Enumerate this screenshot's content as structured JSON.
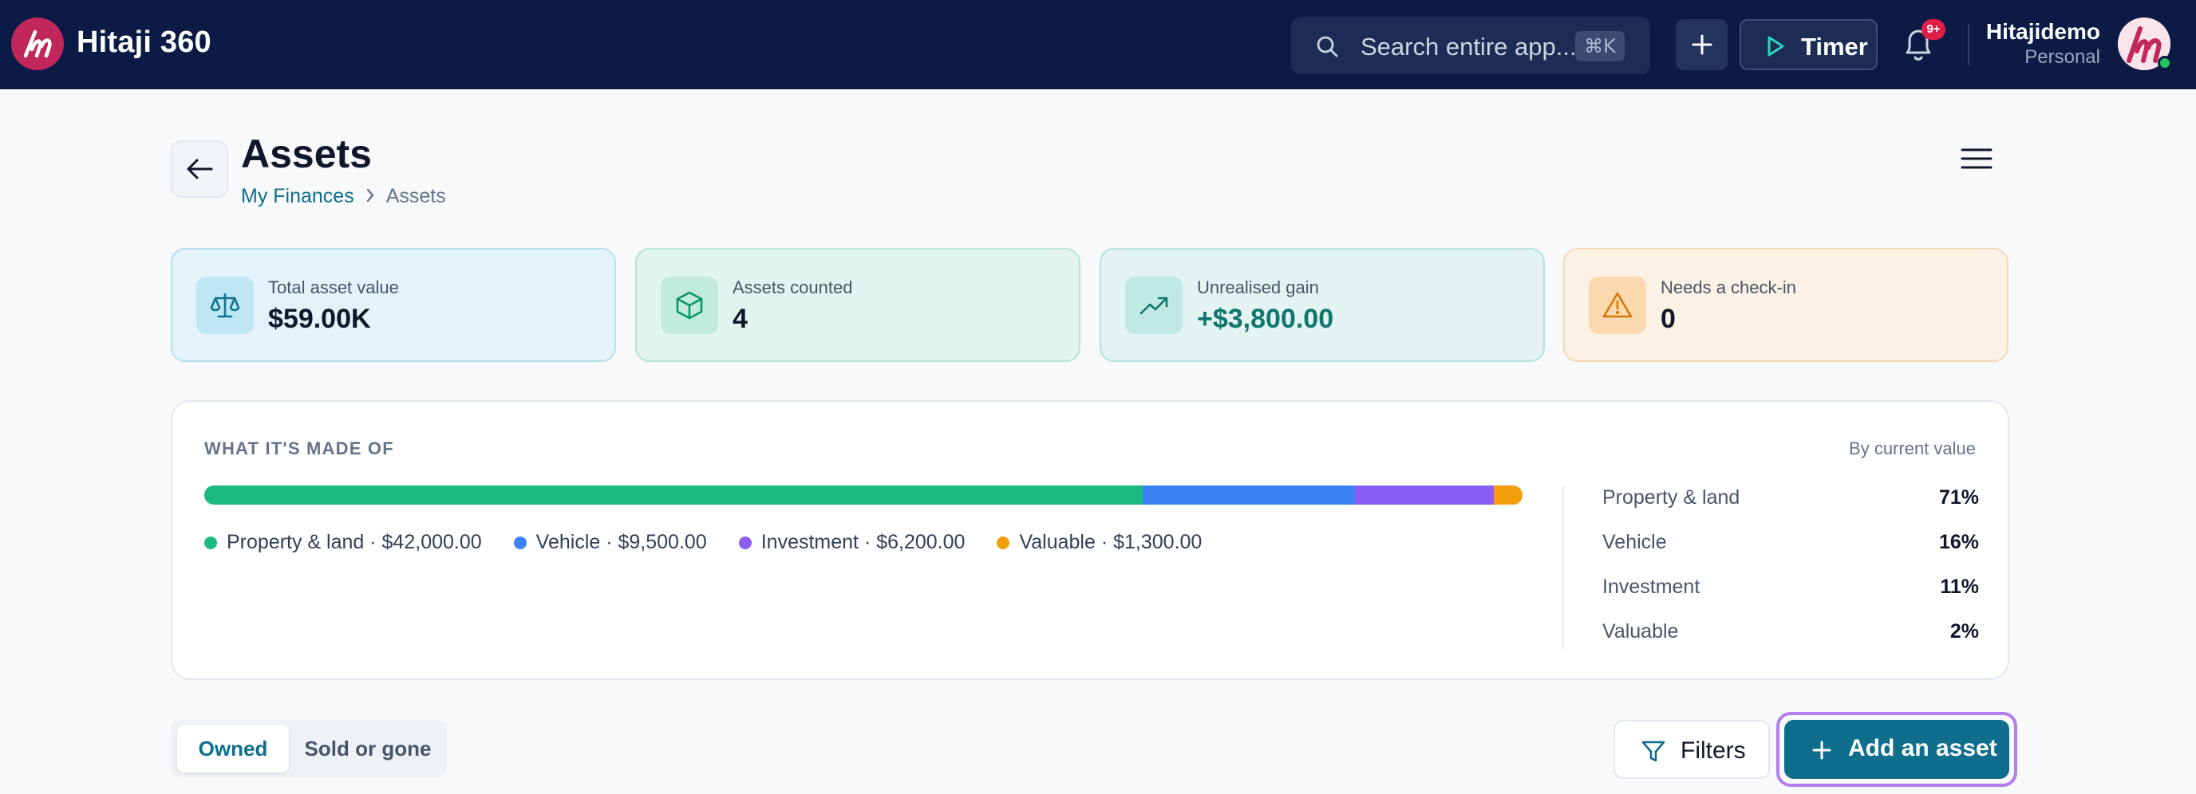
{
  "app": {
    "title": "Hitaji 360",
    "logo_icon": "hitaji-logo-icon"
  },
  "topbar": {
    "search_placeholder": "Search entire app...",
    "search_shortcut": "⌘K",
    "timer_label": "Timer",
    "notifications_badge": "9+",
    "user_name": "Hitajidemo",
    "user_plan": "Personal"
  },
  "page": {
    "title": "Assets",
    "breadcrumb": {
      "parent": "My Finances",
      "current": "Assets"
    }
  },
  "stats": [
    {
      "label": "Total asset value",
      "value": "$59.00K",
      "icon": "scale-icon",
      "accent": "#0e7490"
    },
    {
      "label": "Assets counted",
      "value": "4",
      "icon": "cube-icon",
      "accent": "#059669"
    },
    {
      "label": "Unrealised gain",
      "value": "+$3,800.00",
      "icon": "trending-up-icon",
      "accent": "#0f766e"
    },
    {
      "label": "Needs a check-in",
      "value": "0",
      "icon": "warning-icon",
      "accent": "#d97706"
    }
  ],
  "composition": {
    "title": "WHAT IT'S MADE OF",
    "subtitle": "By current value",
    "segments": [
      {
        "name": "Property & land",
        "amount": "$42,000.00",
        "value": 42000,
        "percent": "71%",
        "color": "#1dbb82",
        "legend": "Property & land · $42,000.00"
      },
      {
        "name": "Vehicle",
        "amount": "$9,500.00",
        "value": 9500,
        "percent": "16%",
        "color": "#3b82f6",
        "legend": "Vehicle · $9,500.00"
      },
      {
        "name": "Investment",
        "amount": "$6,200.00",
        "value": 6200,
        "percent": "11%",
        "color": "#8b5cf6",
        "legend": "Investment · $6,200.00"
      },
      {
        "name": "Valuable",
        "amount": "$1,300.00",
        "value": 1300,
        "percent": "2%",
        "color": "#f59e0b",
        "legend": "Valuable · $1,300.00"
      }
    ]
  },
  "filters": {
    "tab_owned": "Owned",
    "tab_sold": "Sold or gone",
    "filters_label": "Filters",
    "add_label": "Add an asset"
  }
}
